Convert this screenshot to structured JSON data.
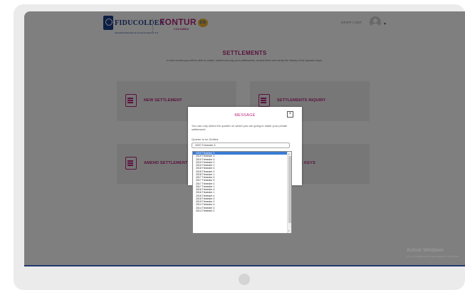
{
  "header": {
    "logo_left": "FIDUCOLDEX",
    "logo_left_sub": "Sociedad Fiduciaria de Comercio Exterior S.A.",
    "logo_right": "FONTUR",
    "logo_right_badge": "co",
    "logo_right_sub": "COLOMBIA",
    "user_text": "STAFF | OUT"
  },
  "page": {
    "title": "SETTLEMENTS",
    "subtitle": "In this module you will be able to create, submit and pay your settlements, consult them and verify the history of the dynamic keys."
  },
  "cards": [
    {
      "label": "NEW SETTLEMENT",
      "icon": "document-plus-icon"
    },
    {
      "label": "SETTLEMENTS INQUIRY",
      "icon": "document-search-icon"
    },
    {
      "label": "AMEND SETTLEMENT",
      "icon": "document-edit-icon"
    },
    {
      "label": "AL DYNAMIC KEYS",
      "icon": "key-icon"
    }
  ],
  "modal": {
    "title": "MESSAGE",
    "close": "×",
    "message": "You can only select the quarter on which you are going to make your private settlement!",
    "label": "Quarter to be Settled:",
    "selected_value": "2020 Trimestre 3"
  },
  "dropdown": {
    "selected_index": 0,
    "options": [
      "2020 Trimestre 3",
      "2019 Trimestre 4",
      "2019 Trimestre 3",
      "2019 Trimestre 2",
      "2019 Trimestre 1",
      "2018 Trimestre 4",
      "2018 Trimestre 2",
      "2018 Trimestre 1",
      "2017 Trimestre 4",
      "2017 Trimestre 3",
      "2017 Trimestre 2",
      "2017 Trimestre 1",
      "2016 Trimestre 4",
      "2016 Trimestre 1",
      "2015 Trimestre 4",
      "2015 Trimestre 3",
      "2015 Trimestre 2",
      "2014 Trimestre 4",
      "2014 Trimestre 3",
      "2014 Trimestre 2"
    ]
  },
  "watermark": {
    "line1": "Activar Windows",
    "line2": "Ve a Configuración para activar Windows."
  },
  "colors": {
    "accent": "#b6257c",
    "brand_blue": "#1d3f8a",
    "selected": "#3a7bd5"
  }
}
